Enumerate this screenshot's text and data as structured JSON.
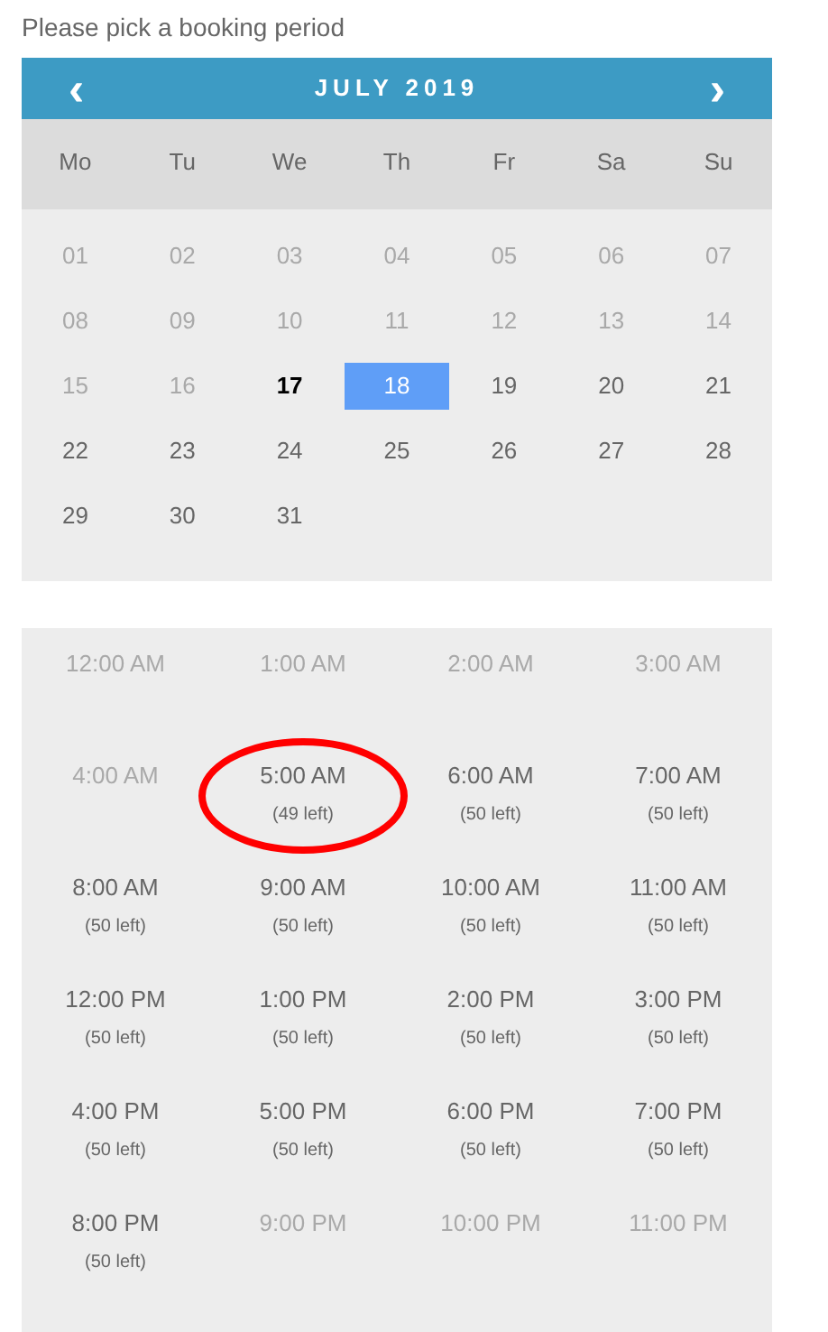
{
  "prompt": "Please pick a booking period",
  "calendar": {
    "month": "JULY 2019",
    "prev": "‹",
    "next": "›",
    "weekdays": [
      "Mo",
      "Tu",
      "We",
      "Th",
      "Fr",
      "Sa",
      "Su"
    ],
    "days": [
      {
        "label": "01",
        "disabled": true,
        "today": false,
        "selected": false
      },
      {
        "label": "02",
        "disabled": true,
        "today": false,
        "selected": false
      },
      {
        "label": "03",
        "disabled": true,
        "today": false,
        "selected": false
      },
      {
        "label": "04",
        "disabled": true,
        "today": false,
        "selected": false
      },
      {
        "label": "05",
        "disabled": true,
        "today": false,
        "selected": false
      },
      {
        "label": "06",
        "disabled": true,
        "today": false,
        "selected": false
      },
      {
        "label": "07",
        "disabled": true,
        "today": false,
        "selected": false
      },
      {
        "label": "08",
        "disabled": true,
        "today": false,
        "selected": false
      },
      {
        "label": "09",
        "disabled": true,
        "today": false,
        "selected": false
      },
      {
        "label": "10",
        "disabled": true,
        "today": false,
        "selected": false
      },
      {
        "label": "11",
        "disabled": true,
        "today": false,
        "selected": false
      },
      {
        "label": "12",
        "disabled": true,
        "today": false,
        "selected": false
      },
      {
        "label": "13",
        "disabled": true,
        "today": false,
        "selected": false
      },
      {
        "label": "14",
        "disabled": true,
        "today": false,
        "selected": false
      },
      {
        "label": "15",
        "disabled": true,
        "today": false,
        "selected": false
      },
      {
        "label": "16",
        "disabled": true,
        "today": false,
        "selected": false
      },
      {
        "label": "17",
        "disabled": false,
        "today": true,
        "selected": false
      },
      {
        "label": "18",
        "disabled": false,
        "today": false,
        "selected": true
      },
      {
        "label": "19",
        "disabled": false,
        "today": false,
        "selected": false
      },
      {
        "label": "20",
        "disabled": false,
        "today": false,
        "selected": false
      },
      {
        "label": "21",
        "disabled": false,
        "today": false,
        "selected": false
      },
      {
        "label": "22",
        "disabled": false,
        "today": false,
        "selected": false
      },
      {
        "label": "23",
        "disabled": false,
        "today": false,
        "selected": false
      },
      {
        "label": "24",
        "disabled": false,
        "today": false,
        "selected": false
      },
      {
        "label": "25",
        "disabled": false,
        "today": false,
        "selected": false
      },
      {
        "label": "26",
        "disabled": false,
        "today": false,
        "selected": false
      },
      {
        "label": "27",
        "disabled": false,
        "today": false,
        "selected": false
      },
      {
        "label": "28",
        "disabled": false,
        "today": false,
        "selected": false
      },
      {
        "label": "29",
        "disabled": false,
        "today": false,
        "selected": false
      },
      {
        "label": "30",
        "disabled": false,
        "today": false,
        "selected": false
      },
      {
        "label": "31",
        "disabled": false,
        "today": false,
        "selected": false
      }
    ]
  },
  "slots": [
    {
      "time": "12:00 AM",
      "disabled": true,
      "circled": false
    },
    {
      "time": "1:00 AM",
      "disabled": true,
      "circled": false
    },
    {
      "time": "2:00 AM",
      "disabled": true,
      "circled": false
    },
    {
      "time": "3:00 AM",
      "disabled": true,
      "circled": false
    },
    {
      "time": "4:00 AM",
      "disabled": true,
      "circled": false
    },
    {
      "time": "5:00 AM",
      "left": "(49 left)",
      "disabled": false,
      "circled": true
    },
    {
      "time": "6:00 AM",
      "left": "(50 left)",
      "disabled": false,
      "circled": false
    },
    {
      "time": "7:00 AM",
      "left": "(50 left)",
      "disabled": false,
      "circled": false
    },
    {
      "time": "8:00 AM",
      "left": "(50 left)",
      "disabled": false,
      "circled": false
    },
    {
      "time": "9:00 AM",
      "left": "(50 left)",
      "disabled": false,
      "circled": false
    },
    {
      "time": "10:00 AM",
      "left": "(50 left)",
      "disabled": false,
      "circled": false
    },
    {
      "time": "11:00 AM",
      "left": "(50 left)",
      "disabled": false,
      "circled": false
    },
    {
      "time": "12:00 PM",
      "left": "(50 left)",
      "disabled": false,
      "circled": false
    },
    {
      "time": "1:00 PM",
      "left": "(50 left)",
      "disabled": false,
      "circled": false
    },
    {
      "time": "2:00 PM",
      "left": "(50 left)",
      "disabled": false,
      "circled": false
    },
    {
      "time": "3:00 PM",
      "left": "(50 left)",
      "disabled": false,
      "circled": false
    },
    {
      "time": "4:00 PM",
      "left": "(50 left)",
      "disabled": false,
      "circled": false
    },
    {
      "time": "5:00 PM",
      "left": "(50 left)",
      "disabled": false,
      "circled": false
    },
    {
      "time": "6:00 PM",
      "left": "(50 left)",
      "disabled": false,
      "circled": false
    },
    {
      "time": "7:00 PM",
      "left": "(50 left)",
      "disabled": false,
      "circled": false
    },
    {
      "time": "8:00 PM",
      "left": "(50 left)",
      "disabled": false,
      "circled": false
    },
    {
      "time": "9:00 PM",
      "disabled": true,
      "circled": false
    },
    {
      "time": "10:00 PM",
      "disabled": true,
      "circled": false
    },
    {
      "time": "11:00 PM",
      "disabled": true,
      "circled": false
    }
  ]
}
